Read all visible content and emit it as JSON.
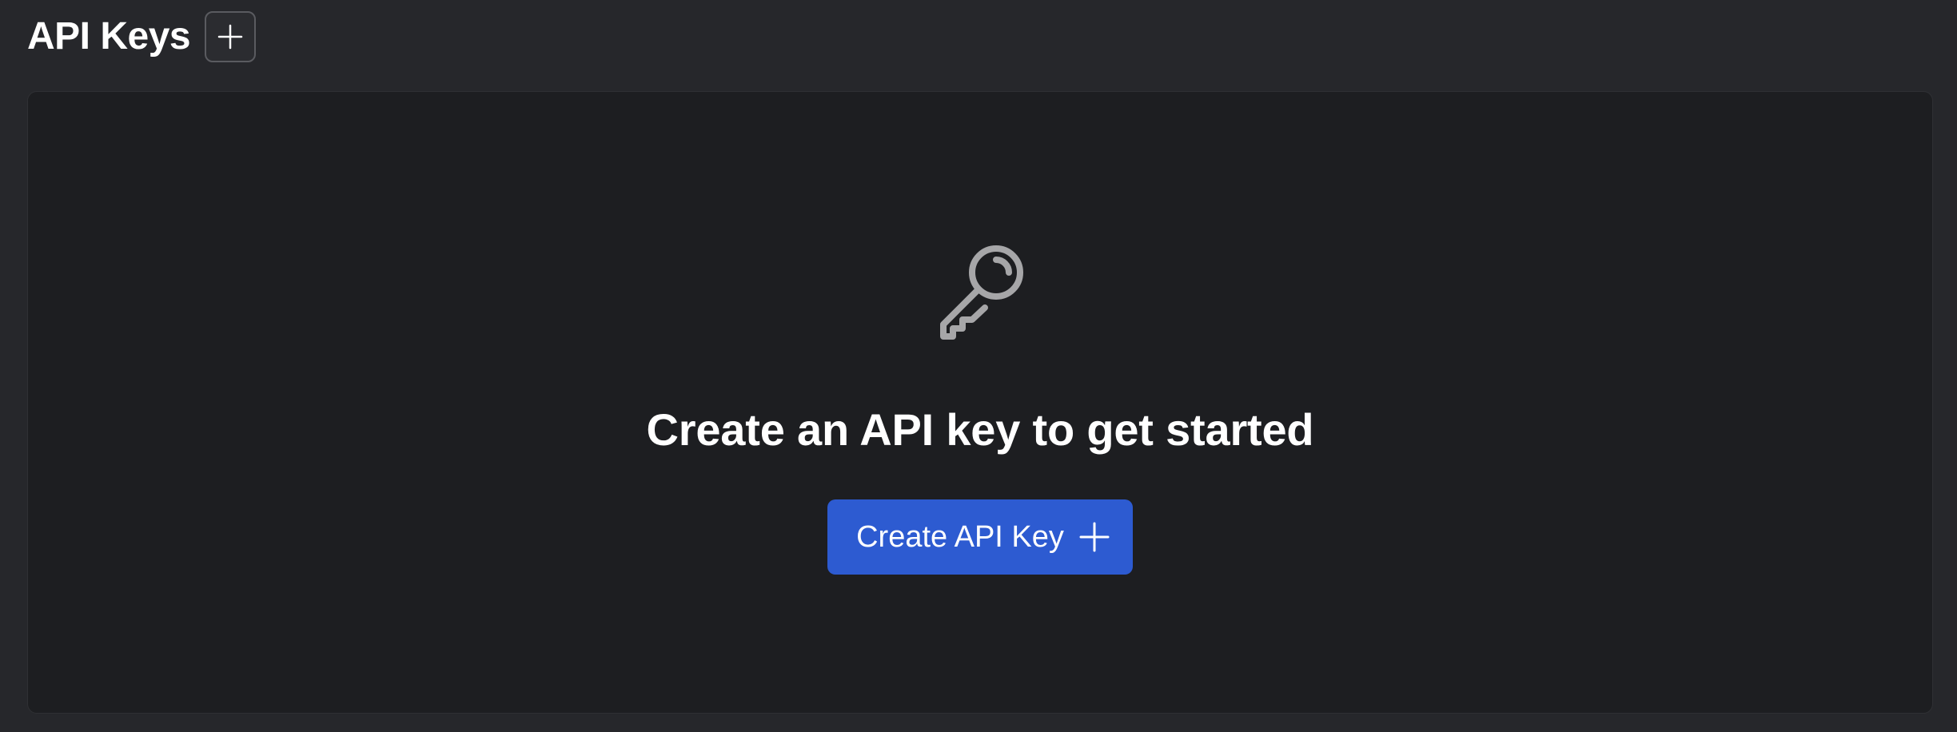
{
  "header": {
    "title": "API Keys",
    "add_icon": "plus-icon"
  },
  "empty_state": {
    "icon": "key-icon",
    "title": "Create an API key to get started",
    "button_label": "Create API Key",
    "button_icon": "plus-icon"
  },
  "colors": {
    "background": "#26272b",
    "panel": "#1d1e21",
    "accent": "#2d5bd1",
    "icon": "#a6a6a8"
  }
}
